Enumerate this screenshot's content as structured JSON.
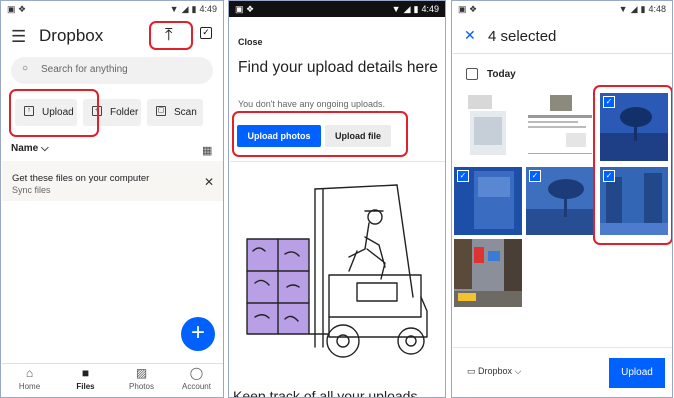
{
  "panel1": {
    "status": {
      "time": "4:49"
    },
    "header": {
      "title": "Dropbox",
      "menu_icon": "hamburger-icon",
      "upload_icon": "upload-icon",
      "select_icon": "checkbox-icon"
    },
    "search": {
      "placeholder": "Search for anything"
    },
    "quick_actions": [
      {
        "label": "Upload",
        "icon": "upload-photo-icon"
      },
      {
        "label": "Folder",
        "icon": "folder-add-icon"
      },
      {
        "label": "Scan",
        "icon": "scan-icon"
      }
    ],
    "sort": {
      "label": "Name"
    },
    "banner": {
      "title": "Get these files on your computer",
      "subtitle": "Sync files"
    },
    "bottom_nav": [
      {
        "label": "Home",
        "icon": "home-icon"
      },
      {
        "label": "Files",
        "icon": "folder-icon",
        "active": true
      },
      {
        "label": "Photos",
        "icon": "photos-icon"
      },
      {
        "label": "Account",
        "icon": "person-icon"
      }
    ],
    "fab_icon": "plus-icon"
  },
  "panel2": {
    "status": {
      "time": "4:49"
    },
    "close_label": "Close",
    "heading": "Find your upload details here",
    "subtext": "You don't have any ongoing uploads.",
    "upload_photos_label": "Upload photos",
    "upload_file_label": "Upload file",
    "bottom_text": "Keep track of all your uploads"
  },
  "panel3": {
    "status": {
      "time": "4:48"
    },
    "selected_title": "4 selected",
    "section": "Today",
    "folder_label": "Dropbox",
    "upload_label": "Upload",
    "accent": "#0061fe"
  },
  "colors": {
    "accent": "#0061fe",
    "highlight": "#e0202a"
  }
}
